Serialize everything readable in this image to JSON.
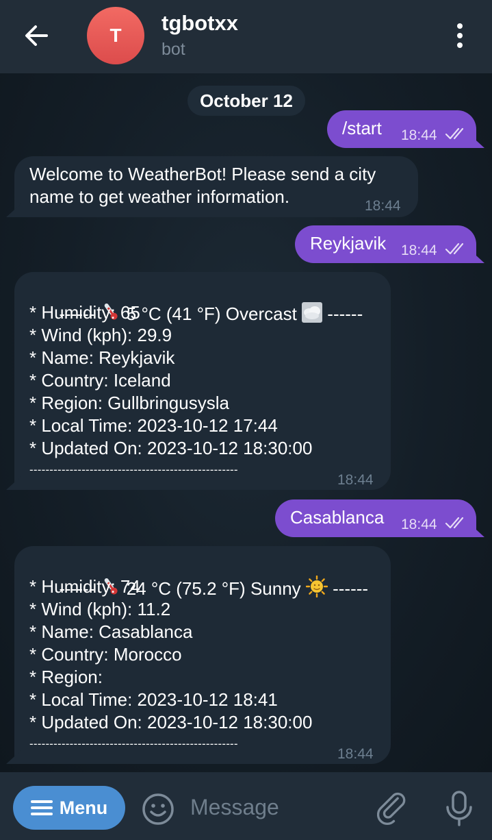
{
  "header": {
    "avatar_letter": "T",
    "title": "tgbotxx",
    "subtitle": "bot",
    "icons": [
      "arrow-left-icon",
      "more-vertical-icon"
    ]
  },
  "chat": {
    "date": "October 12",
    "messages": [
      {
        "direction": "out",
        "text": "/start",
        "time": "18:44",
        "status": "read"
      },
      {
        "direction": "in",
        "lines": [
          "Welcome to WeatherBot! Please send a city",
          "name to get weather information."
        ],
        "time": "18:44"
      },
      {
        "direction": "out",
        "text": "Reykjavik",
        "time": "18:44",
        "status": "read"
      },
      {
        "direction": "in",
        "header_prefix": "------ ",
        "header_text": " 5 °C (41 °F) Overcast ",
        "header_suffix": " ------",
        "header_icons": [
          "thermometer-icon",
          "overcast-icon"
        ],
        "lines": [
          "* Humidity: 65",
          "* Wind (kph): 29.9",
          "* Name: Reykjavik",
          "* Country: Iceland",
          "* Region: Gullbringusysla",
          "* Local Time: 2023-10-12 17:44",
          "* Updated On: 2023-10-12 18:30:00"
        ],
        "footer": "----------------------------------------------------",
        "time": "18:44"
      },
      {
        "direction": "out",
        "text": "Casablanca",
        "time": "18:44",
        "status": "read"
      },
      {
        "direction": "in",
        "header_prefix": "------ ",
        "header_text": " 24 °C (75.2 °F) Sunny ",
        "header_suffix": " ------",
        "header_icons": [
          "thermometer-icon",
          "sun-icon"
        ],
        "lines": [
          "* Humidity: 74",
          "* Wind (kph): 11.2",
          "* Name: Casablanca",
          "* Country: Morocco",
          "* Region:",
          "* Local Time: 2023-10-12 18:41",
          "* Updated On: 2023-10-12 18:30:00"
        ],
        "footer": "----------------------------------------------------",
        "time": "18:44"
      }
    ]
  },
  "input_bar": {
    "menu_label": "Menu",
    "placeholder": "Message",
    "value": "",
    "icons": [
      "hamburger-icon",
      "emoji-icon",
      "paperclip-icon",
      "microphone-icon"
    ]
  },
  "colors": {
    "header_bg": "#222d38",
    "outgoing_bubble": "#7c4dcf",
    "incoming_bubble": "#1e2a36",
    "menu_button": "#4a8ed2",
    "avatar": "#e85b58"
  }
}
